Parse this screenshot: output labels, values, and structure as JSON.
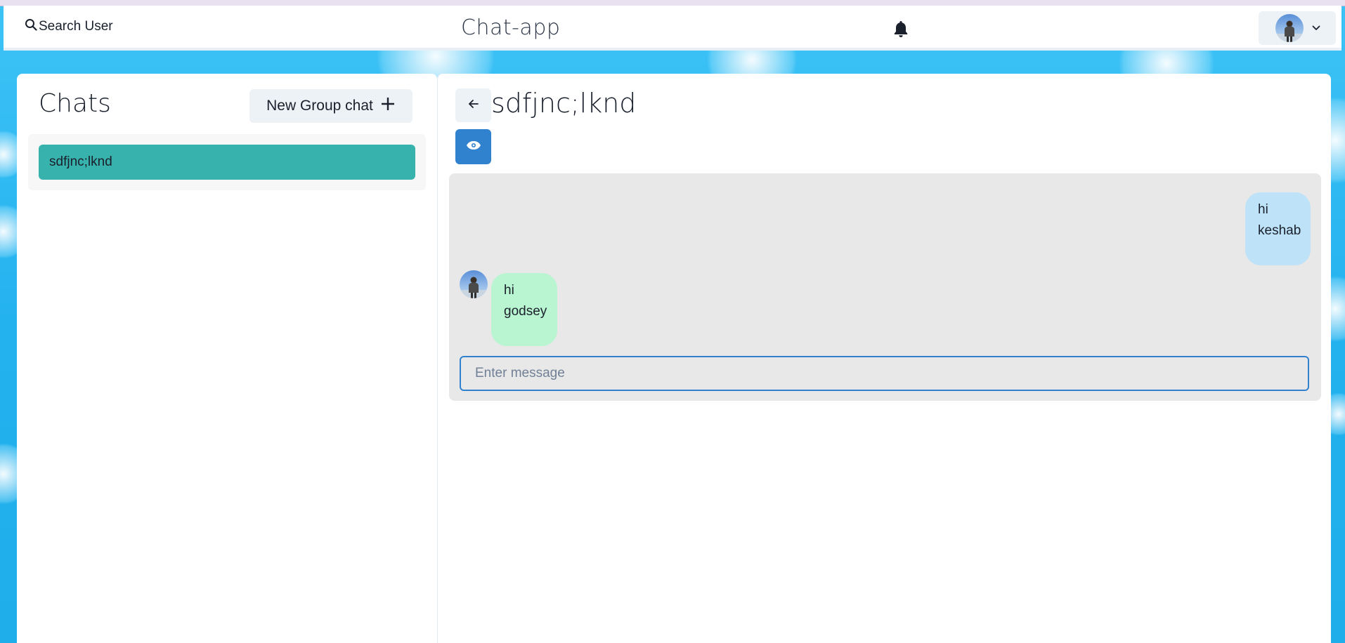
{
  "header": {
    "search_label": "Search User",
    "app_title": "Chat-app"
  },
  "sidebar": {
    "title": "Chats",
    "new_group_label": "New Group chat",
    "chats": [
      {
        "name": "sdfjnc;lknd",
        "selected": true
      }
    ]
  },
  "chat": {
    "name": "sdfjnc;lknd",
    "messages": [
      {
        "from": "me",
        "text": "hi keshab"
      },
      {
        "from": "other",
        "text": "hi godsey"
      }
    ],
    "input_placeholder": "Enter message",
    "input_value": ""
  },
  "colors": {
    "selected_chat": "#38b2ac",
    "outgoing_bubble": "#bee3f8",
    "incoming_bubble": "#b9f5d0",
    "eye_button": "#3182ce"
  },
  "icons": [
    "search-icon",
    "bell-icon",
    "chevron-down-icon",
    "plus-icon",
    "arrow-left-icon",
    "eye-icon"
  ]
}
